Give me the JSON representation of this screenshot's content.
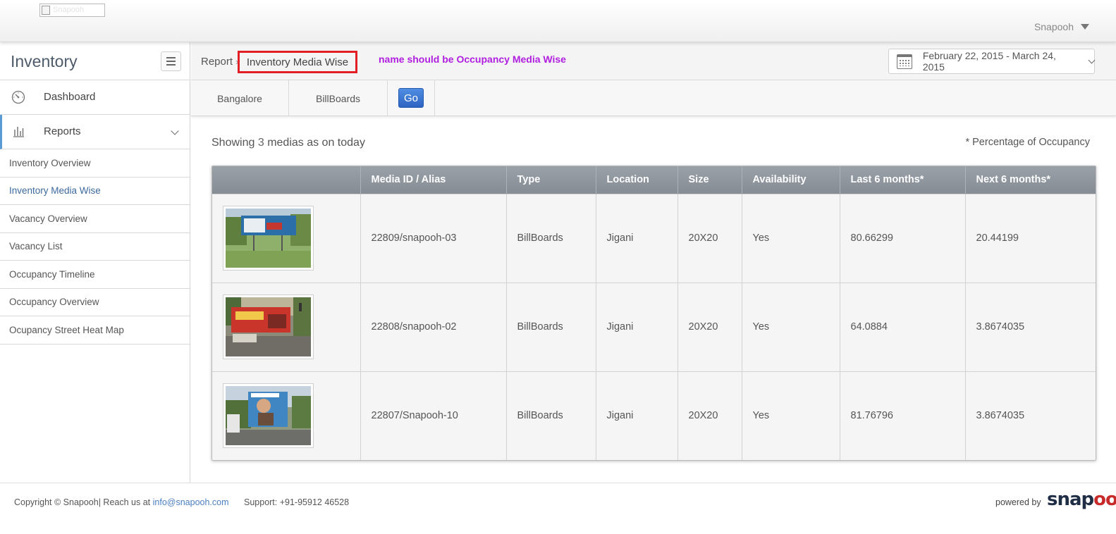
{
  "header": {
    "logo_alt": "Snapooh",
    "user_name": "Snapooh"
  },
  "sidebar": {
    "title": "Inventory",
    "nav": [
      {
        "label": "Dashboard",
        "icon": "dashboard-gauge-icon"
      },
      {
        "label": "Reports",
        "icon": "bar-chart-icon"
      }
    ],
    "submenu": [
      "Inventory Overview",
      "Inventory Media Wise",
      "Vacancy Overview",
      "Vacancy List",
      "Occupancy Timeline",
      "Occupancy Overview",
      "Ocupancy Street Heat Map"
    ]
  },
  "breadcrumb": {
    "root": "Report",
    "separator": "›",
    "current": "Inventory Media Wise"
  },
  "annotation": "name should be Occupancy Media Wise",
  "date_range": "February 22, 2015 - March 24, 2015",
  "filters": {
    "city": "Bangalore",
    "media_type": "BillBoards",
    "go_label": "Go"
  },
  "summary": {
    "prefix": "Showing",
    "count": "3",
    "suffix": "medias as on today",
    "note": "* Percentage of Occupancy"
  },
  "table": {
    "headers": [
      "",
      "Media ID / Alias",
      "Type",
      "Location",
      "Size",
      "Availability",
      "Last 6 months*",
      "Next 6 months*"
    ],
    "rows": [
      {
        "media_id": "22809/snapooh-03",
        "type": "BillBoards",
        "location": "Jigani",
        "size": "20X20",
        "availability": "Yes",
        "last6": "80.66299",
        "next6": "20.44199"
      },
      {
        "media_id": "22808/snapooh-02",
        "type": "BillBoards",
        "location": "Jigani",
        "size": "20X20",
        "availability": "Yes",
        "last6": "64.0884",
        "next6": "3.8674035"
      },
      {
        "media_id": "22807/Snapooh-10",
        "type": "BillBoards",
        "location": "Jigani",
        "size": "20X20",
        "availability": "Yes",
        "last6": "81.76796",
        "next6": "3.8674035"
      }
    ]
  },
  "footer": {
    "copyright": "Copyright © Snapooh| Reach us at",
    "email": "info@snapooh.com",
    "support": "Support: +91-95912 46528",
    "powered_by": "powered by",
    "brand_part1": "snap",
    "brand_part2": "ooh"
  },
  "colors": {
    "highlight_box": "#e01f26",
    "annotation": "#b01ee0",
    "go_button": "#2d64c2",
    "table_header": "#8d949b",
    "active_nav_border": "#5a9bd5"
  }
}
